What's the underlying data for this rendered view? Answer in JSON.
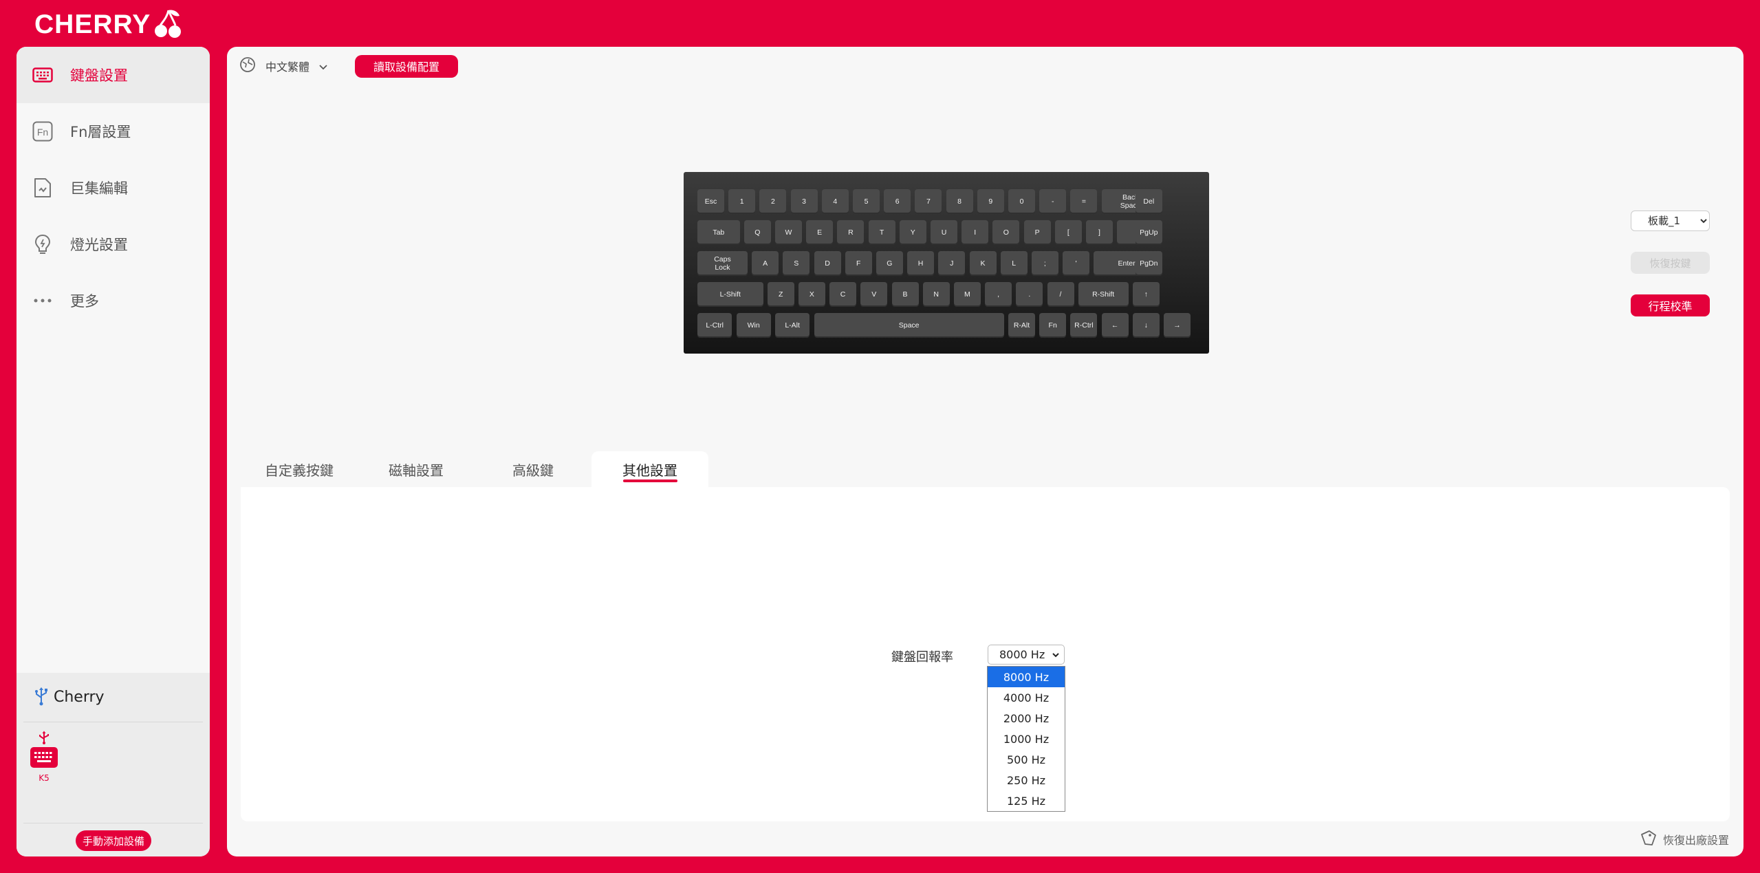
{
  "brand": {
    "name": "CHERRY"
  },
  "sidebar": {
    "items": [
      {
        "label": "鍵盤設置",
        "icon": "keyboard-icon",
        "active": true
      },
      {
        "label": "Fn層設置",
        "icon": "fn-icon",
        "active": false
      },
      {
        "label": "巨集編輯",
        "icon": "macro-file-icon",
        "active": false
      },
      {
        "label": "燈光設置",
        "icon": "lightbulb-icon",
        "active": false
      },
      {
        "label": "更多",
        "icon": "more-dots-icon",
        "active": false
      }
    ],
    "device_group": {
      "name": "Cherry",
      "icon": "usb-icon"
    },
    "device": {
      "name": "K5",
      "icon": "keyboard-device-icon"
    },
    "add_device_label": "手動添加設備"
  },
  "topbar": {
    "language": "中文繁體",
    "read_config_label": "讀取設備配置"
  },
  "keyboard": {
    "rows": [
      [
        "Esc",
        "1",
        "2",
        "3",
        "4",
        "5",
        "6",
        "7",
        "8",
        "9",
        "0",
        "-",
        "=",
        "Back\nSpace",
        "Del"
      ],
      [
        "Tab",
        "Q",
        "W",
        "E",
        "R",
        "T",
        "Y",
        "U",
        "I",
        "O",
        "P",
        "[",
        "]",
        "\\",
        "PgUp"
      ],
      [
        "Caps\nLock",
        "A",
        "S",
        "D",
        "F",
        "G",
        "H",
        "J",
        "K",
        "L",
        ";",
        "'",
        "Enter",
        "PgDn"
      ],
      [
        "L-Shift",
        "Z",
        "X",
        "C",
        "V",
        "B",
        "N",
        "M",
        ",",
        ".",
        "/",
        "R-Shift",
        "↑"
      ],
      [
        "L-Ctrl",
        "Win",
        "L-Alt",
        "Space",
        "R-Alt",
        "Fn",
        "R-Ctrl",
        "←",
        "↓",
        "→"
      ]
    ]
  },
  "controls": {
    "profile_selected": "板載_1",
    "restore_key_label": "恢復按鍵",
    "calibrate_label": "行程校準"
  },
  "tabs": [
    {
      "label": "自定義按鍵",
      "active": false
    },
    {
      "label": "磁軸設置",
      "active": false
    },
    {
      "label": "高級鍵",
      "active": false
    },
    {
      "label": "其他設置",
      "active": true
    }
  ],
  "other_settings": {
    "polling_rate_label": "鍵盤回報率",
    "polling_rate_value": "8000 Hz",
    "polling_rate_options": [
      "8000 Hz",
      "4000 Hz",
      "2000 Hz",
      "1000 Hz",
      "500 Hz",
      "250 Hz",
      "125 Hz"
    ],
    "highlighted_option": "8000 Hz"
  },
  "footer": {
    "factory_reset_label": "恢復出廠設置"
  },
  "colors": {
    "accent": "#e4003b",
    "panel": "#f7f7f7",
    "dropdown_highlight": "#1a6ee6"
  }
}
